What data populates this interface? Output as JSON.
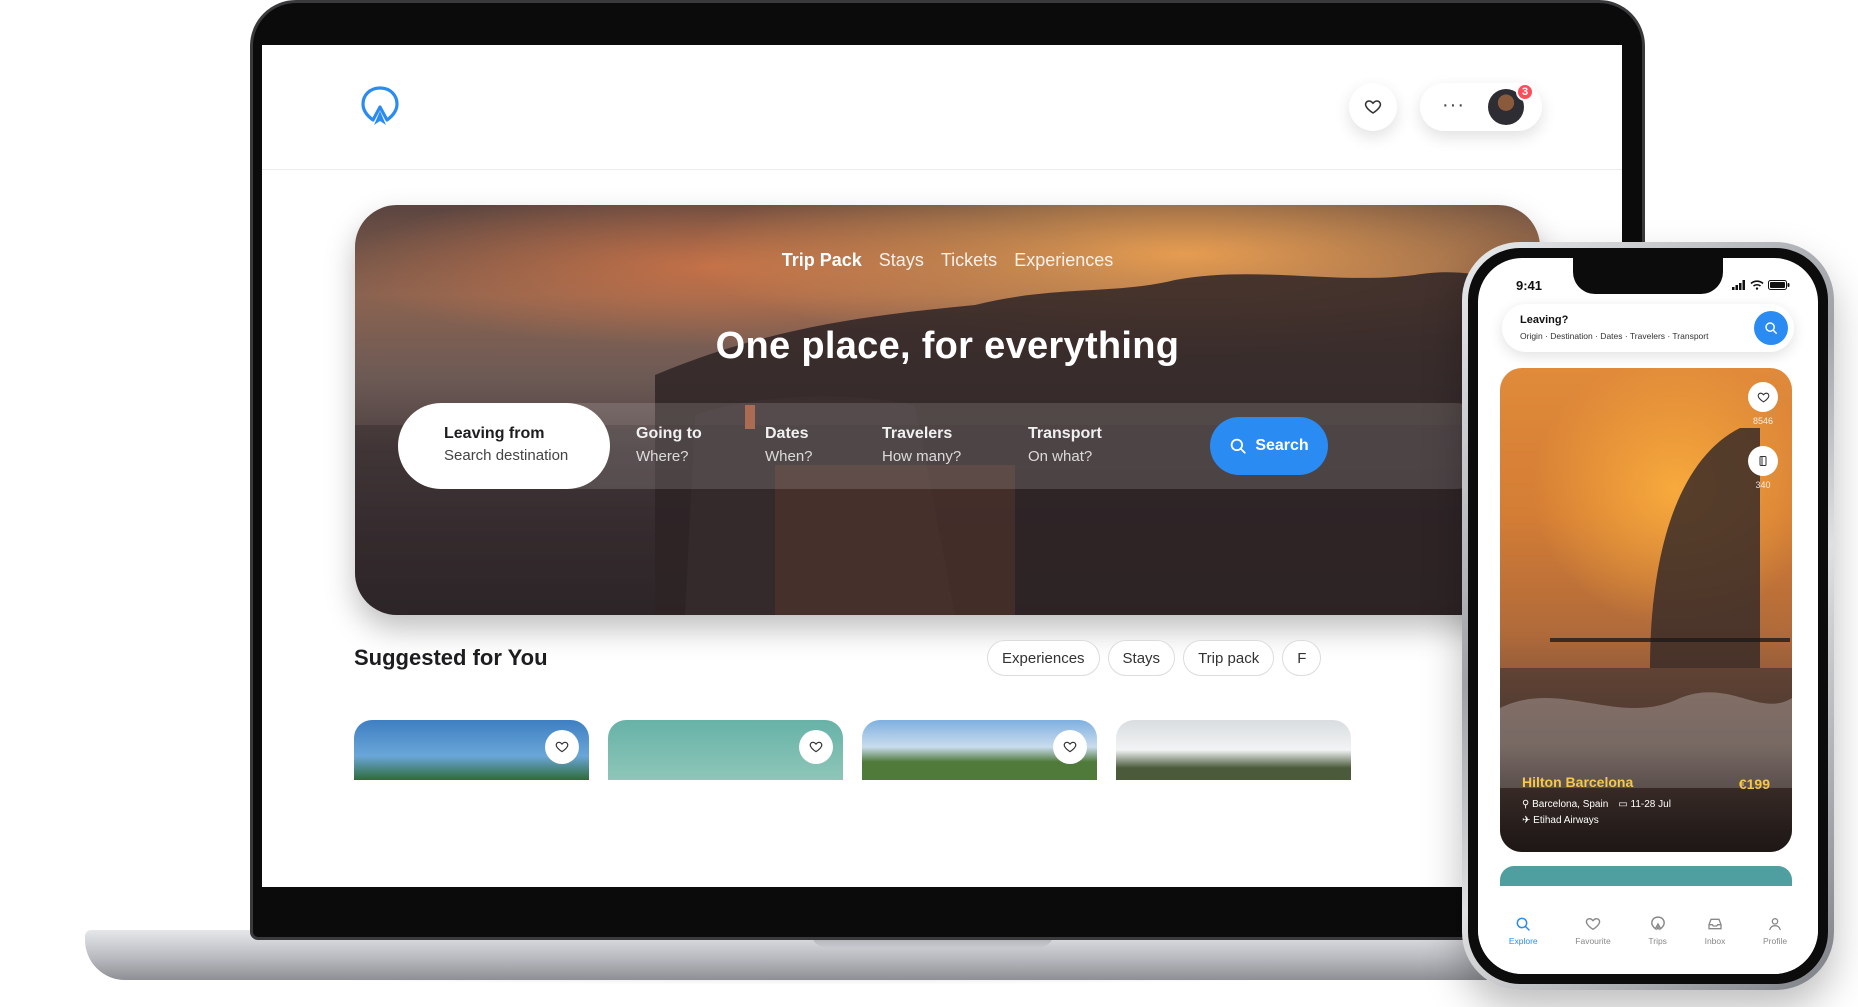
{
  "desktop": {
    "header": {
      "notification_count": "3"
    },
    "hero": {
      "tabs": [
        "Trip Pack",
        "Stays",
        "Tickets",
        "Experiences"
      ],
      "title": "One place, for everything",
      "search": {
        "leaving": {
          "label": "Leaving from",
          "placeholder": "Search destination"
        },
        "going": {
          "label": "Going to",
          "placeholder": "Where?"
        },
        "dates": {
          "label": "Dates",
          "placeholder": "When?"
        },
        "travelers": {
          "label": "Travelers",
          "placeholder": "How many?"
        },
        "transport": {
          "label": "Transport",
          "placeholder": "On what?"
        },
        "button": "Search"
      }
    },
    "suggested": {
      "title": "Suggested for You",
      "chips": [
        "Experiences",
        "Stays",
        "Trip pack",
        "F"
      ]
    }
  },
  "mobile": {
    "status_time": "9:41",
    "search": {
      "label": "Leaving?",
      "sub": "Origin · Destination · Dates · Travelers · Transport"
    },
    "hotel": {
      "name": "Hilton Barcelona",
      "price": "€199",
      "location": "Barcelona, Spain",
      "dates": "11-28 Jul",
      "airline": "Etihad Airways",
      "likes": "8546",
      "saves": "340"
    },
    "tabs": [
      "Explore",
      "Favourite",
      "Trips",
      "Inbox",
      "Profile"
    ]
  },
  "colors": {
    "accent": "#2a8bf2",
    "price": "#f7c64d",
    "badge": "#ff4d5a"
  }
}
